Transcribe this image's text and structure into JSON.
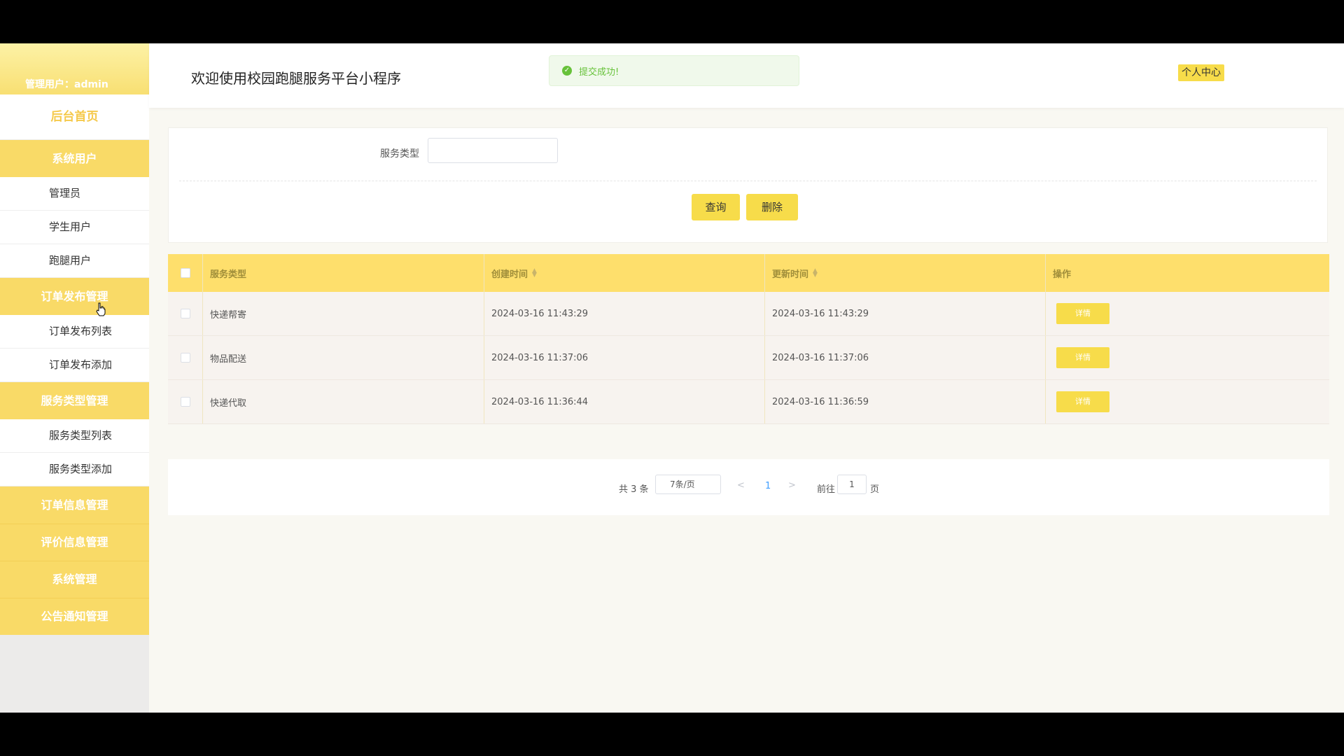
{
  "sidebar": {
    "user_label": "管理用户：admin",
    "home": "后台首页",
    "groups": [
      {
        "label": "系统用户",
        "items": [
          "管理员",
          "学生用户",
          "跑腿用户"
        ]
      },
      {
        "label": "订单发布管理",
        "items": [
          "订单发布列表",
          "订单发布添加"
        ]
      },
      {
        "label": "服务类型管理",
        "items": [
          "服务类型列表",
          "服务类型添加"
        ]
      },
      {
        "label": "订单信息管理",
        "items": []
      },
      {
        "label": "评价信息管理",
        "items": []
      },
      {
        "label": "系统管理",
        "items": []
      },
      {
        "label": "公告通知管理",
        "items": []
      }
    ]
  },
  "header": {
    "title": "欢迎使用校园跑腿服务平台小程序",
    "toast": "提交成功!",
    "profile_button": "个人中心"
  },
  "search": {
    "label": "服务类型",
    "value": "",
    "query_button": "查询",
    "delete_button": "删除"
  },
  "table": {
    "columns": [
      "服务类型",
      "创建时间",
      "更新时间",
      "操作"
    ],
    "rows": [
      {
        "type": "快递帮寄",
        "created": "2024-03-16 11:43:29",
        "updated": "2024-03-16 11:43:29",
        "action": "详情"
      },
      {
        "type": "物品配送",
        "created": "2024-03-16 11:37:06",
        "updated": "2024-03-16 11:37:06",
        "action": "详情"
      },
      {
        "type": "快递代取",
        "created": "2024-03-16 11:36:44",
        "updated": "2024-03-16 11:36:59",
        "action": "详情"
      }
    ]
  },
  "pager": {
    "total": "共 3 条",
    "page_size": "7条/页",
    "current_page": "1",
    "goto_label": "前往",
    "goto_value": "1",
    "page_suffix": "页"
  },
  "icons": {
    "toast": "check-circle-icon",
    "prev": "chevron-left-icon",
    "next": "chevron-right-icon",
    "sort": "sort-caret-icon"
  },
  "colors": {
    "accent": "#f9da67",
    "header_row": "#fedf6c",
    "success": "#67c23a",
    "link": "#409eff"
  }
}
